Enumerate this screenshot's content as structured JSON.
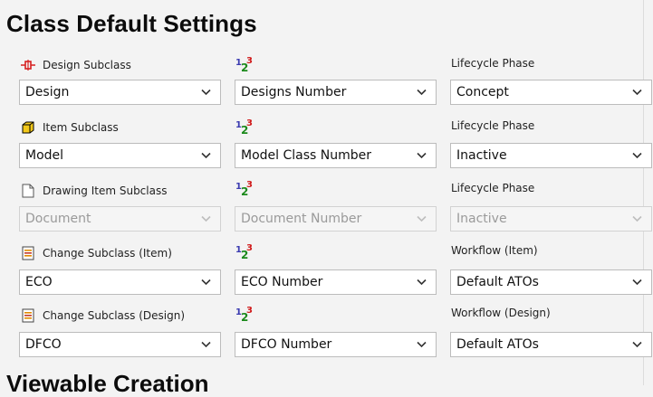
{
  "title": "Class Default Settings",
  "next_section_title": "Viewable Creation",
  "rows": [
    {
      "label": "Design Subclass",
      "icon": "design-subclass-icon",
      "subclass": "Design",
      "number": "Designs Number",
      "third_label": "Lifecycle Phase",
      "third_value": "Concept",
      "disabled": false
    },
    {
      "label": "Item Subclass",
      "icon": "item-cube-icon",
      "subclass": "Model",
      "number": "Model Class Number",
      "third_label": "Lifecycle Phase",
      "third_value": "Inactive",
      "disabled": false
    },
    {
      "label": "Drawing Item Subclass",
      "icon": "document-icon",
      "subclass": "Document",
      "number": "Document Number",
      "third_label": "Lifecycle Phase",
      "third_value": "Inactive",
      "disabled": true
    },
    {
      "label": "Change Subclass (Item)",
      "icon": "change-document-icon",
      "subclass": "ECO",
      "number": "ECO Number",
      "third_label": "Workflow (Item)",
      "third_value": "Default ATOs",
      "disabled": false
    },
    {
      "label": "Change Subclass (Design)",
      "icon": "change-document-icon",
      "subclass": "DFCO",
      "number": "DFCO Number",
      "third_label": "Workflow (Design)",
      "third_value": "Default ATOs",
      "disabled": false
    }
  ]
}
